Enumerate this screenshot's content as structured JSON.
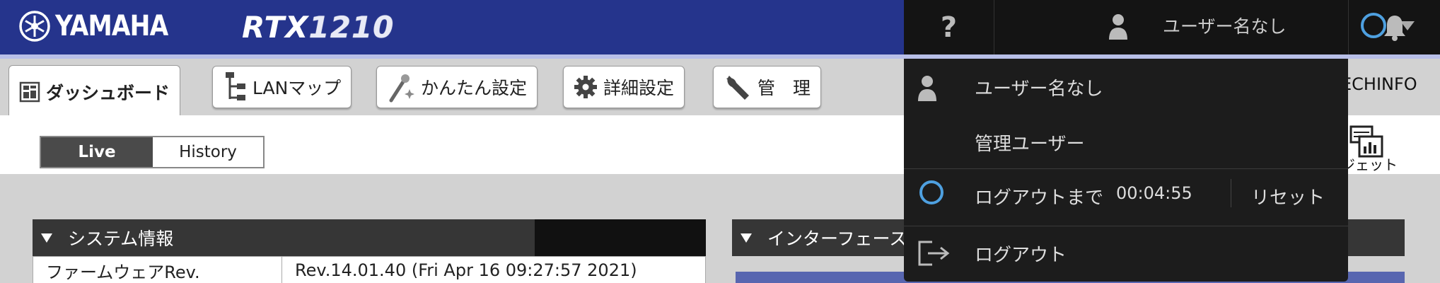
{
  "header": {
    "brand": "YAMAHA",
    "model_prefix": "RTX",
    "model_number": "1210",
    "help_label": "?",
    "user_name": "ユーザー名なし"
  },
  "nav": {
    "tabs": [
      {
        "label": "ダッシュボード",
        "icon": "dashboard-icon",
        "active": true
      },
      {
        "label": "LANマップ",
        "icon": "lanmap-icon"
      },
      {
        "label": "かんたん設定",
        "icon": "magic-wand-icon"
      },
      {
        "label": "詳細設定",
        "icon": "gear-icon"
      },
      {
        "label": "管　理",
        "icon": "wrench-icon"
      }
    ],
    "techinfo_label": "ECHINFO"
  },
  "view_toggle": {
    "live_label": "Live",
    "history_label": "History",
    "selected": "Live"
  },
  "widget": {
    "label": "ジェット"
  },
  "panels": {
    "system_info": {
      "title": "システム情報",
      "rows": [
        {
          "key": "ファームウェアRev.",
          "value": "Rev.14.01.40 (Fri Apr 16 09:27:57 2021)"
        }
      ]
    },
    "interface": {
      "title": "インターフェース"
    }
  },
  "user_menu": {
    "user_name": "ユーザー名なし",
    "role": "管理ユーザー",
    "logout_timer_label": "ログアウトまで",
    "logout_timer_value": "00:04:55",
    "reset_label": "リセット",
    "logout_label": "ログアウト"
  },
  "colors": {
    "header_bg": "#25348c",
    "header_stripe": "#b8bfe8",
    "topbar_dark": "#141414",
    "menu_bg": "#1c1c1c",
    "timer_ring": "#4ea0e0",
    "panel_head": "#363636"
  }
}
